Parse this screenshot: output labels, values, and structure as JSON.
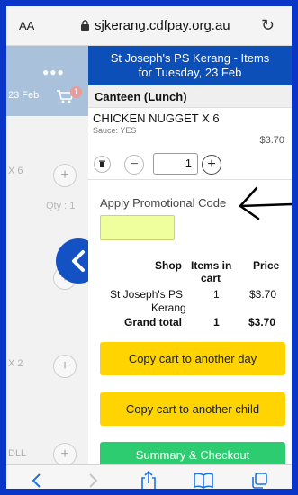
{
  "browser": {
    "aa_label": "AA",
    "url": "sjkerang.cdfpay.org.au",
    "reload_glyph": "↻",
    "accent_color": "#0a36c8"
  },
  "background_page": {
    "dots": "●●●",
    "date": "23 Feb",
    "cart_badge": "1",
    "item_1": "X 6",
    "qty_label": "Qty : 1",
    "item_2": "X 2",
    "item_3": "DLL",
    "plus": "+"
  },
  "panel": {
    "title_line1": "St Joseph's PS Kerang - Items",
    "title_line2": "for Tuesday, 23 Feb",
    "section": "Canteen (Lunch)",
    "product_name": "CHICKEN NUGGET X 6",
    "product_option": "Sauce: YES",
    "product_price": "$3.70",
    "quantity": "1",
    "minus": "−",
    "plus": "+",
    "promo_label": "Apply Promotional Code",
    "promo_value": ""
  },
  "cart_table": {
    "headers": {
      "shop": "Shop",
      "items_line1": "Items in",
      "items_line2": "cart",
      "price": "Price"
    },
    "row": {
      "shop_line1": "St Joseph's PS",
      "shop_line2": "Kerang",
      "items": "1",
      "price": "$3.70"
    },
    "total": {
      "label": "Grand total",
      "items": "1",
      "price": "$3.70"
    }
  },
  "buttons": {
    "copy_day": "Copy cart to another day",
    "copy_child": "Copy cart to another child",
    "checkout": "Summary & Checkout"
  },
  "toolbar": {
    "back": "back-icon",
    "forward": "forward-icon",
    "share": "share-icon",
    "bookmarks": "bookmarks-icon",
    "tabs": "tabs-icon"
  }
}
